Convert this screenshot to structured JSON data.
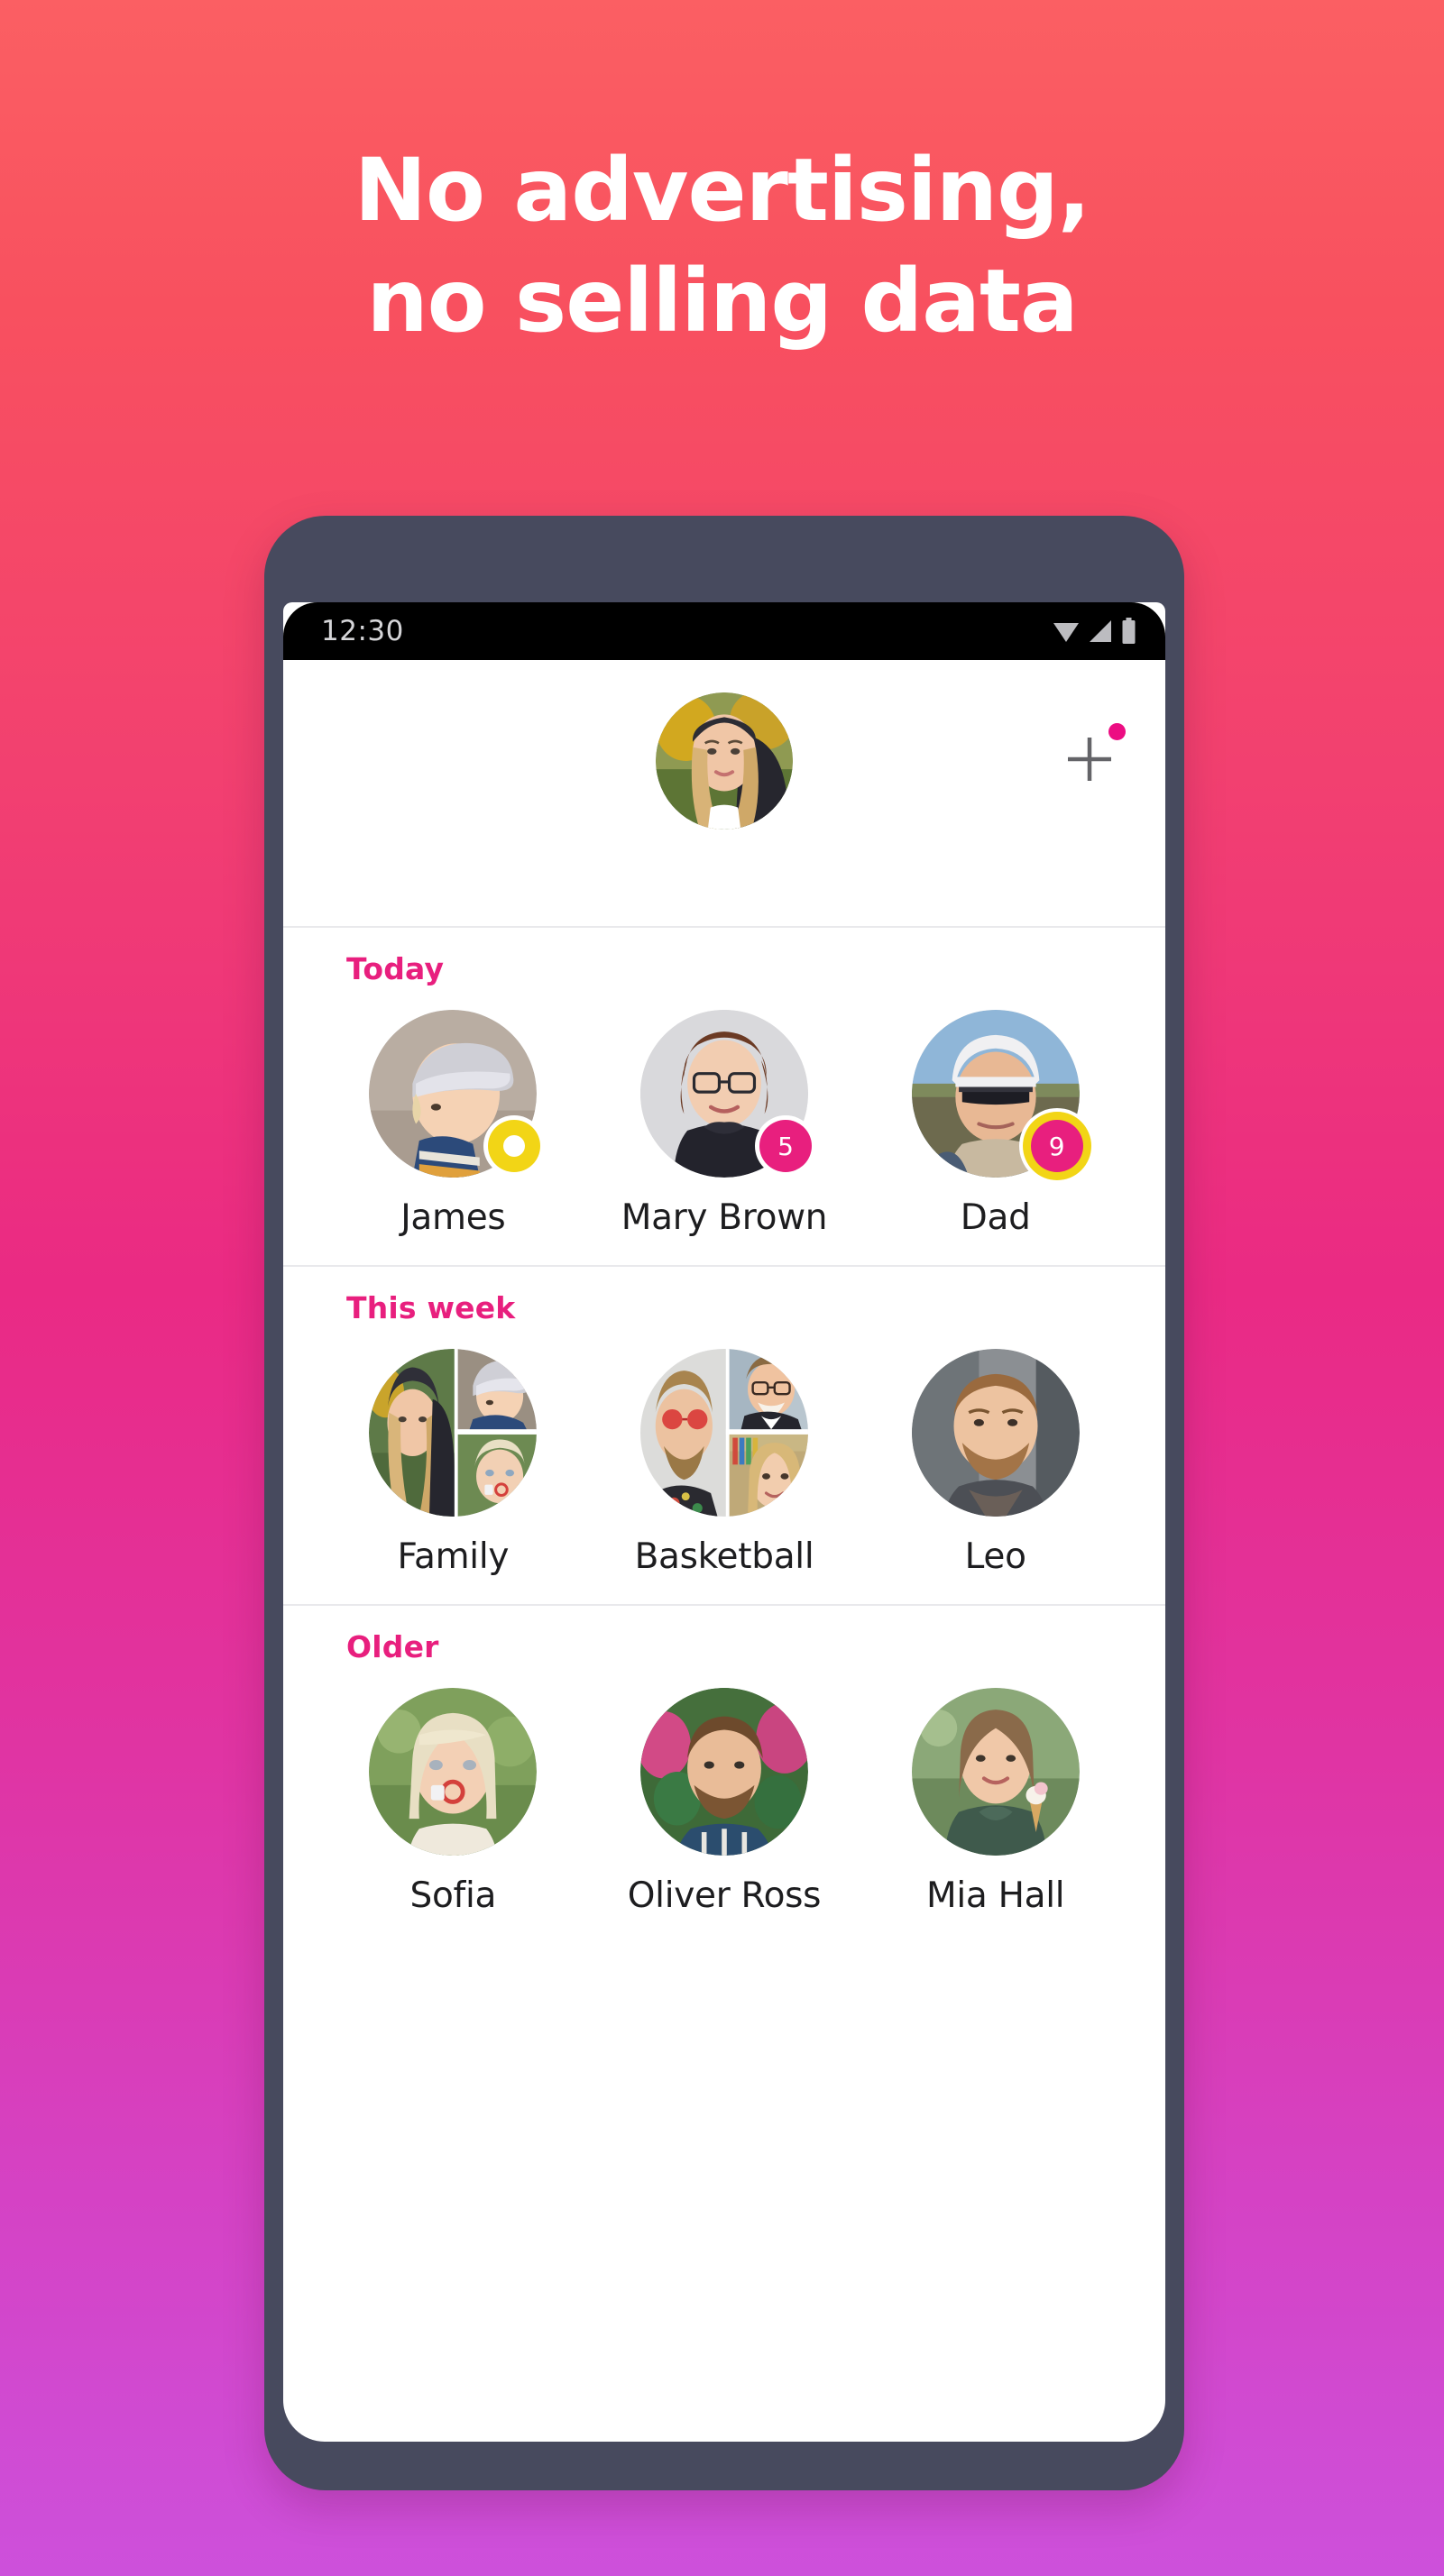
{
  "promo": {
    "headline_line1": "No advertising,",
    "headline_line2": "no selling data",
    "background_top_color": "#fb5f63",
    "background_mid_color": "#ea2a84",
    "background_bottom_color": "#cd50db",
    "accent_color": "#e81f7e",
    "badge_yellow": "#f2d516",
    "phone_frame_color": "#474a5e"
  },
  "status_bar": {
    "time": "12:30",
    "icons": [
      "wifi-icon",
      "signal-icon",
      "battery-icon"
    ]
  },
  "header": {
    "self_avatar_name": "self-avatar",
    "add_button_label": "+",
    "add_button_icon": "plus-icon",
    "add_badge_icon": "notification-dot-icon"
  },
  "sections": [
    {
      "title": "Today",
      "contacts": [
        {
          "name": "James",
          "avatar": "boy-in-cap-photo",
          "badge": {
            "type": "ring",
            "value": ""
          }
        },
        {
          "name": "Mary Brown",
          "avatar": "woman-glasses-photo",
          "badge": {
            "type": "count",
            "value": "5"
          }
        },
        {
          "name": "Dad",
          "avatar": "man-helmet-photo",
          "badge": {
            "type": "count-ring",
            "value": "9"
          }
        }
      ]
    },
    {
      "title": "This week",
      "contacts": [
        {
          "name": "Family",
          "avatar": "group-collage-family",
          "badge": null
        },
        {
          "name": "Basketball",
          "avatar": "group-collage-basketball",
          "badge": null
        },
        {
          "name": "Leo",
          "avatar": "man-beard-photo",
          "badge": null
        }
      ]
    },
    {
      "title": "Older",
      "contacts": [
        {
          "name": "Sofia",
          "avatar": "woman-bubbles-photo",
          "badge": null
        },
        {
          "name": "Oliver Ross",
          "avatar": "man-flowers-photo",
          "badge": null
        },
        {
          "name": "Mia Hall",
          "avatar": "woman-icecream-photo",
          "badge": null
        }
      ]
    }
  ]
}
